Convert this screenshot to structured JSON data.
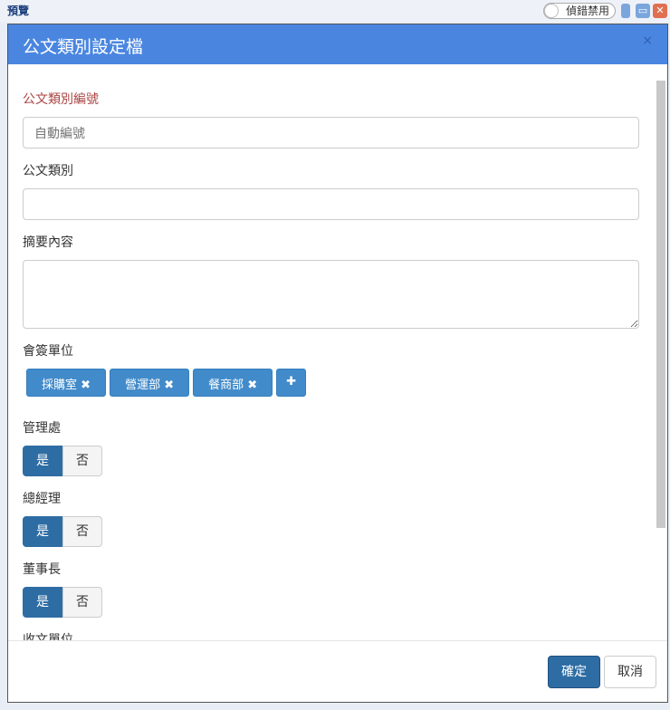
{
  "window": {
    "title": "預覽",
    "debug_toggle": "偵錯禁用"
  },
  "modal": {
    "title": "公文類別設定檔",
    "close": "×",
    "fields": {
      "id_label": "公文類別編號",
      "id_placeholder": "自動編號",
      "type_label": "公文類別",
      "summary_label": "摘要內容",
      "cosign_label": "會簽單位",
      "receive_label": "收文單位"
    },
    "tags": [
      "採購室",
      "營運部",
      "餐商部"
    ],
    "tag_remove": "✖",
    "tag_add": "✚",
    "toggles": [
      {
        "label": "管理處",
        "yes": "是",
        "no": "否",
        "value": "是"
      },
      {
        "label": "總經理",
        "yes": "是",
        "no": "否",
        "value": "是"
      },
      {
        "label": "董事長",
        "yes": "是",
        "no": "否",
        "value": "是"
      }
    ],
    "confirm": "確定",
    "cancel": "取消"
  },
  "colors": {
    "header": "#4a86e0",
    "primary": "#2e6da4",
    "tag": "#428bca"
  }
}
